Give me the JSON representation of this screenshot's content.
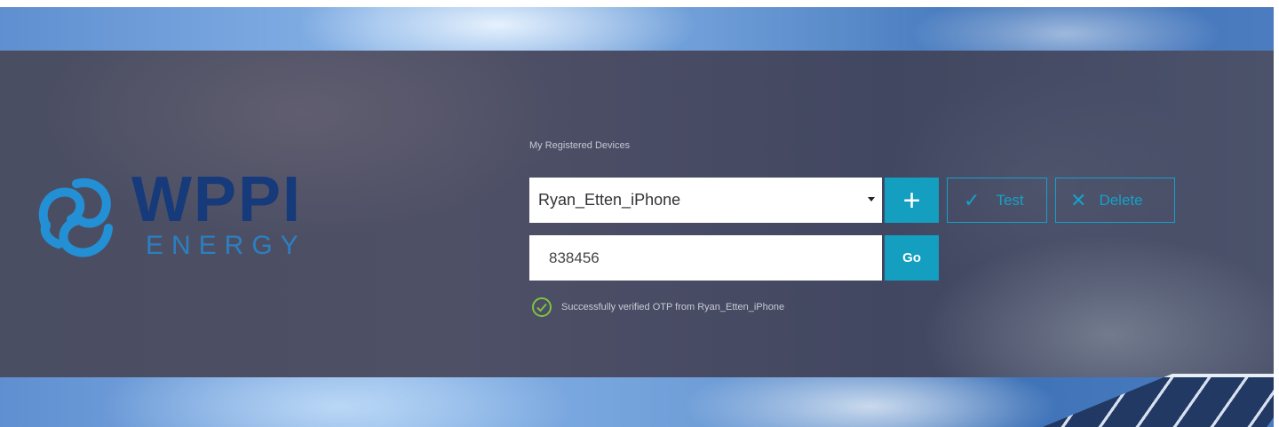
{
  "brand": {
    "wordmark": "WPPI",
    "subtitle": "ENERGY"
  },
  "devices": {
    "section_label": "My Registered Devices",
    "selected_device": "Ryan_Etten_iPhone",
    "add_label": "+",
    "test_label": "Test",
    "delete_label": "Delete"
  },
  "otp": {
    "value": "838456",
    "go_label": "Go"
  },
  "status": {
    "message": "Successfully verified OTP from Ryan_Etten_iPhone"
  },
  "colors": {
    "accent": "#149ec0",
    "brand_dark_blue": "#163a7a",
    "brand_light_blue": "#2b7fc2",
    "success_green": "#7fc241"
  },
  "icons": {
    "logo": "wppi-swirl-logo-icon",
    "select_caret": "chevron-down-icon",
    "add": "plus-icon",
    "test": "check-icon",
    "delete": "close-icon",
    "status": "check-circle-icon"
  }
}
